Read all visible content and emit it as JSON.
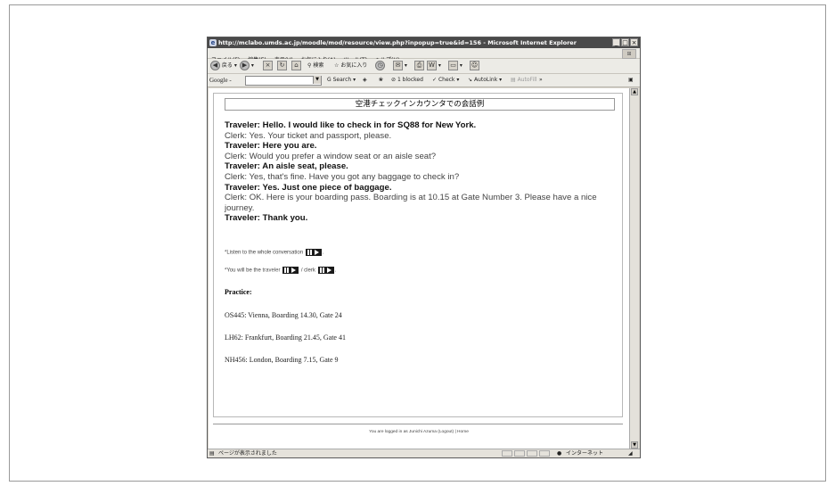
{
  "window": {
    "title": "http://mclabo.umds.ac.jp/moodle/mod/resource/view.php?inpopup=true&id=156 - Microsoft Internet Explorer",
    "controls": [
      "_",
      "□",
      "×"
    ]
  },
  "menu": [
    "ファイル(F)",
    "編集(E)",
    "表示(V)",
    "お気に入り(A)",
    "ツール(T)",
    "ヘルプ(H)"
  ],
  "toolbar": {
    "back": "戻る",
    "search": "検索",
    "favorites": "お気に入り"
  },
  "googlebar": {
    "logo": "Google -",
    "search_label": "Search",
    "blocked": "1 blocked",
    "check": "Check",
    "autolink": "AutoLink",
    "autofill": "AutoFill",
    "more": "»"
  },
  "page": {
    "heading": "空港チェックインカウンタでの会話例",
    "dialog": [
      {
        "speaker": "traveler",
        "text": "Traveler: Hello.  I would like to check in for SQ88 for New York."
      },
      {
        "speaker": "clerk",
        "text": "Clerk: Yes.  Your ticket and passport, please."
      },
      {
        "speaker": "traveler",
        "text": "Traveler: Here you are."
      },
      {
        "speaker": "clerk",
        "text": "Clerk: Would you prefer a window seat or an aisle seat?"
      },
      {
        "speaker": "traveler",
        "text": "Traveler: An aisle seat, please."
      },
      {
        "speaker": "clerk",
        "text": "Clerk: Yes, that's fine.  Have you got any baggage to check in?"
      },
      {
        "speaker": "traveler",
        "text": "Traveler: Yes.  Just one piece of baggage."
      },
      {
        "speaker": "clerk",
        "text": "Clerk: OK.  Here is your boarding pass.  Boarding is at 10.15 at Gate Number 3.  Please have a nice journey."
      },
      {
        "speaker": "traveler",
        "text": "Traveler: Thank you."
      }
    ],
    "listen_text": "*Listen to the whole conversation",
    "role_prefix": "*You will be the",
    "role_traveler": "traveler",
    "role_sep": "/ clerk",
    "practice_title": "Practice:",
    "practice": [
      "OS445: Vienna, Boarding 14.30, Gate 24",
      "LH62: Frankfurt, Boarding 21.45, Gate 41",
      "NH456: London, Boarding 7.15, Gate 9"
    ],
    "footer": "You are logged in as Junichi Azuma (Logout) | Home"
  },
  "status": {
    "left": "ページが表示されました",
    "zone": "インターネット"
  }
}
